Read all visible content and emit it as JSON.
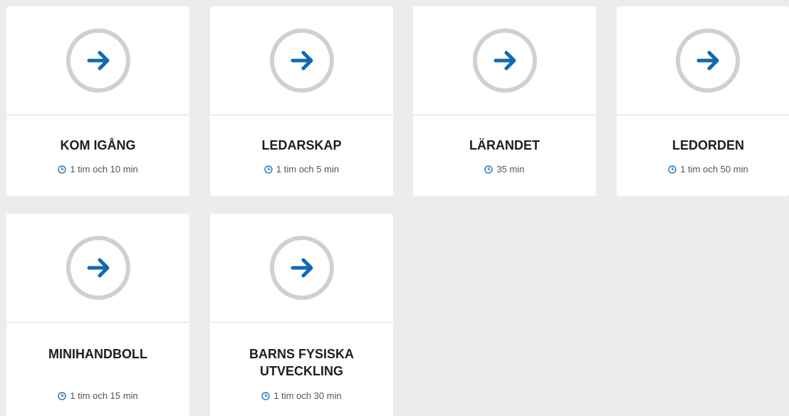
{
  "colors": {
    "background": "#ececec",
    "card": "#ffffff",
    "accent": "#0f6ab4",
    "ring": "#d0d0d0",
    "title": "#1e1e1e"
  },
  "cards": [
    {
      "title": "KOM IGÅNG",
      "duration": "1 tim och 10 min",
      "icon": "arrow-right-icon"
    },
    {
      "title": "LEDARSKAP",
      "duration": "1 tim och 5 min",
      "icon": "arrow-right-icon"
    },
    {
      "title": "LÄRANDET",
      "duration": "35 min",
      "icon": "arrow-right-icon"
    },
    {
      "title": "LEDORDEN",
      "duration": "1 tim och 50 min",
      "icon": "arrow-right-icon"
    },
    {
      "title": "MINIHANDBOLL",
      "duration": "1 tim och 15 min",
      "icon": "arrow-right-icon"
    },
    {
      "title": "BARNS FYSISKA UTVECKLING",
      "duration": "1 tim och 30 min",
      "icon": "arrow-right-icon"
    }
  ]
}
